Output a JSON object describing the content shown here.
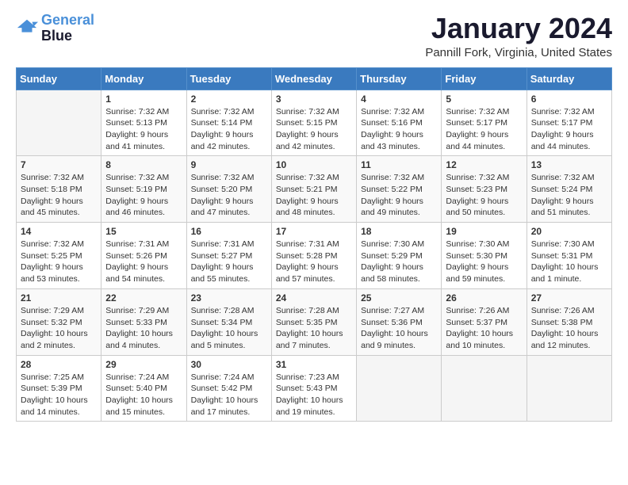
{
  "header": {
    "logo_line1": "General",
    "logo_line2": "Blue",
    "month": "January 2024",
    "location": "Pannill Fork, Virginia, United States"
  },
  "weekdays": [
    "Sunday",
    "Monday",
    "Tuesday",
    "Wednesday",
    "Thursday",
    "Friday",
    "Saturday"
  ],
  "weeks": [
    [
      {
        "day": "",
        "sunrise": "",
        "sunset": "",
        "daylight": ""
      },
      {
        "day": "1",
        "sunrise": "Sunrise: 7:32 AM",
        "sunset": "Sunset: 5:13 PM",
        "daylight": "Daylight: 9 hours and 41 minutes."
      },
      {
        "day": "2",
        "sunrise": "Sunrise: 7:32 AM",
        "sunset": "Sunset: 5:14 PM",
        "daylight": "Daylight: 9 hours and 42 minutes."
      },
      {
        "day": "3",
        "sunrise": "Sunrise: 7:32 AM",
        "sunset": "Sunset: 5:15 PM",
        "daylight": "Daylight: 9 hours and 42 minutes."
      },
      {
        "day": "4",
        "sunrise": "Sunrise: 7:32 AM",
        "sunset": "Sunset: 5:16 PM",
        "daylight": "Daylight: 9 hours and 43 minutes."
      },
      {
        "day": "5",
        "sunrise": "Sunrise: 7:32 AM",
        "sunset": "Sunset: 5:17 PM",
        "daylight": "Daylight: 9 hours and 44 minutes."
      },
      {
        "day": "6",
        "sunrise": "Sunrise: 7:32 AM",
        "sunset": "Sunset: 5:17 PM",
        "daylight": "Daylight: 9 hours and 44 minutes."
      }
    ],
    [
      {
        "day": "7",
        "sunrise": "Sunrise: 7:32 AM",
        "sunset": "Sunset: 5:18 PM",
        "daylight": "Daylight: 9 hours and 45 minutes."
      },
      {
        "day": "8",
        "sunrise": "Sunrise: 7:32 AM",
        "sunset": "Sunset: 5:19 PM",
        "daylight": "Daylight: 9 hours and 46 minutes."
      },
      {
        "day": "9",
        "sunrise": "Sunrise: 7:32 AM",
        "sunset": "Sunset: 5:20 PM",
        "daylight": "Daylight: 9 hours and 47 minutes."
      },
      {
        "day": "10",
        "sunrise": "Sunrise: 7:32 AM",
        "sunset": "Sunset: 5:21 PM",
        "daylight": "Daylight: 9 hours and 48 minutes."
      },
      {
        "day": "11",
        "sunrise": "Sunrise: 7:32 AM",
        "sunset": "Sunset: 5:22 PM",
        "daylight": "Daylight: 9 hours and 49 minutes."
      },
      {
        "day": "12",
        "sunrise": "Sunrise: 7:32 AM",
        "sunset": "Sunset: 5:23 PM",
        "daylight": "Daylight: 9 hours and 50 minutes."
      },
      {
        "day": "13",
        "sunrise": "Sunrise: 7:32 AM",
        "sunset": "Sunset: 5:24 PM",
        "daylight": "Daylight: 9 hours and 51 minutes."
      }
    ],
    [
      {
        "day": "14",
        "sunrise": "Sunrise: 7:32 AM",
        "sunset": "Sunset: 5:25 PM",
        "daylight": "Daylight: 9 hours and 53 minutes."
      },
      {
        "day": "15",
        "sunrise": "Sunrise: 7:31 AM",
        "sunset": "Sunset: 5:26 PM",
        "daylight": "Daylight: 9 hours and 54 minutes."
      },
      {
        "day": "16",
        "sunrise": "Sunrise: 7:31 AM",
        "sunset": "Sunset: 5:27 PM",
        "daylight": "Daylight: 9 hours and 55 minutes."
      },
      {
        "day": "17",
        "sunrise": "Sunrise: 7:31 AM",
        "sunset": "Sunset: 5:28 PM",
        "daylight": "Daylight: 9 hours and 57 minutes."
      },
      {
        "day": "18",
        "sunrise": "Sunrise: 7:30 AM",
        "sunset": "Sunset: 5:29 PM",
        "daylight": "Daylight: 9 hours and 58 minutes."
      },
      {
        "day": "19",
        "sunrise": "Sunrise: 7:30 AM",
        "sunset": "Sunset: 5:30 PM",
        "daylight": "Daylight: 9 hours and 59 minutes."
      },
      {
        "day": "20",
        "sunrise": "Sunrise: 7:30 AM",
        "sunset": "Sunset: 5:31 PM",
        "daylight": "Daylight: 10 hours and 1 minute."
      }
    ],
    [
      {
        "day": "21",
        "sunrise": "Sunrise: 7:29 AM",
        "sunset": "Sunset: 5:32 PM",
        "daylight": "Daylight: 10 hours and 2 minutes."
      },
      {
        "day": "22",
        "sunrise": "Sunrise: 7:29 AM",
        "sunset": "Sunset: 5:33 PM",
        "daylight": "Daylight: 10 hours and 4 minutes."
      },
      {
        "day": "23",
        "sunrise": "Sunrise: 7:28 AM",
        "sunset": "Sunset: 5:34 PM",
        "daylight": "Daylight: 10 hours and 5 minutes."
      },
      {
        "day": "24",
        "sunrise": "Sunrise: 7:28 AM",
        "sunset": "Sunset: 5:35 PM",
        "daylight": "Daylight: 10 hours and 7 minutes."
      },
      {
        "day": "25",
        "sunrise": "Sunrise: 7:27 AM",
        "sunset": "Sunset: 5:36 PM",
        "daylight": "Daylight: 10 hours and 9 minutes."
      },
      {
        "day": "26",
        "sunrise": "Sunrise: 7:26 AM",
        "sunset": "Sunset: 5:37 PM",
        "daylight": "Daylight: 10 hours and 10 minutes."
      },
      {
        "day": "27",
        "sunrise": "Sunrise: 7:26 AM",
        "sunset": "Sunset: 5:38 PM",
        "daylight": "Daylight: 10 hours and 12 minutes."
      }
    ],
    [
      {
        "day": "28",
        "sunrise": "Sunrise: 7:25 AM",
        "sunset": "Sunset: 5:39 PM",
        "daylight": "Daylight: 10 hours and 14 minutes."
      },
      {
        "day": "29",
        "sunrise": "Sunrise: 7:24 AM",
        "sunset": "Sunset: 5:40 PM",
        "daylight": "Daylight: 10 hours and 15 minutes."
      },
      {
        "day": "30",
        "sunrise": "Sunrise: 7:24 AM",
        "sunset": "Sunset: 5:42 PM",
        "daylight": "Daylight: 10 hours and 17 minutes."
      },
      {
        "day": "31",
        "sunrise": "Sunrise: 7:23 AM",
        "sunset": "Sunset: 5:43 PM",
        "daylight": "Daylight: 10 hours and 19 minutes."
      },
      {
        "day": "",
        "sunrise": "",
        "sunset": "",
        "daylight": ""
      },
      {
        "day": "",
        "sunrise": "",
        "sunset": "",
        "daylight": ""
      },
      {
        "day": "",
        "sunrise": "",
        "sunset": "",
        "daylight": ""
      }
    ]
  ]
}
